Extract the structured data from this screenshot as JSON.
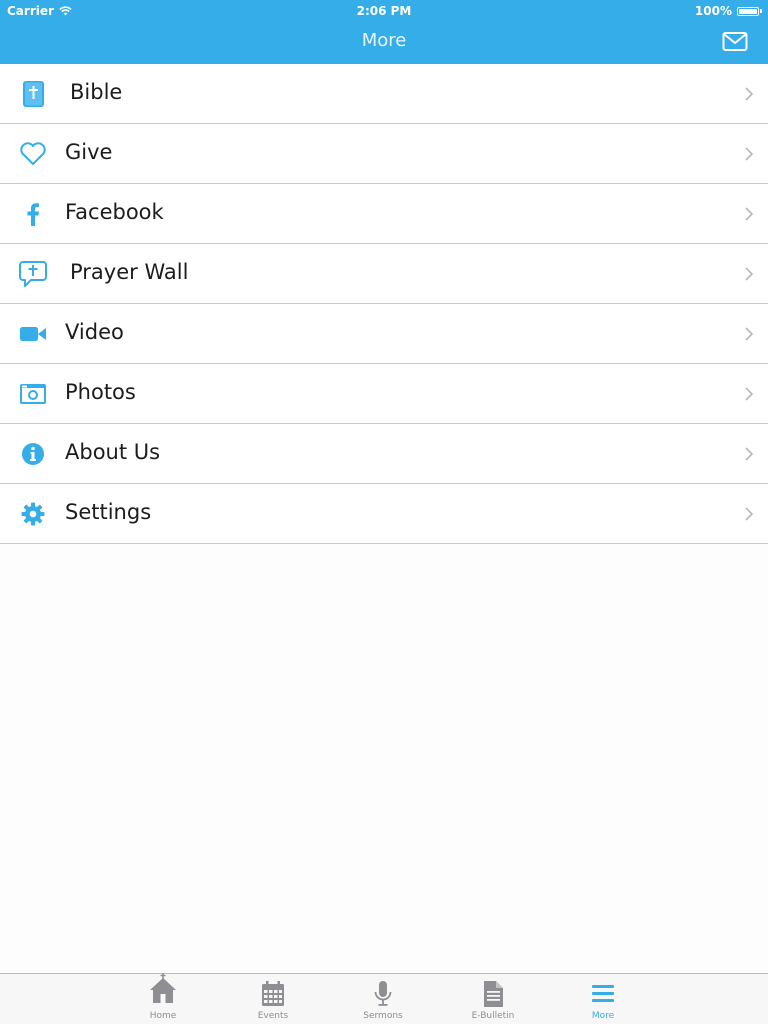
{
  "status_bar": {
    "carrier": "Carrier",
    "time": "2:06 PM",
    "battery": "100%"
  },
  "header": {
    "title": "More",
    "mail_icon": "envelope-icon"
  },
  "menu": {
    "items": [
      {
        "label": "Bible",
        "icon": "bible-icon"
      },
      {
        "label": "Give",
        "icon": "heart-icon"
      },
      {
        "label": "Facebook",
        "icon": "facebook-icon"
      },
      {
        "label": "Prayer Wall",
        "icon": "prayer-bubble-icon"
      },
      {
        "label": "Video",
        "icon": "video-camera-icon"
      },
      {
        "label": "Photos",
        "icon": "camera-icon"
      },
      {
        "label": "About Us",
        "icon": "info-icon"
      },
      {
        "label": "Settings",
        "icon": "gear-icon"
      }
    ]
  },
  "tabbar": {
    "tabs": [
      {
        "label": "Home",
        "icon": "church-icon"
      },
      {
        "label": "Events",
        "icon": "calendar-icon"
      },
      {
        "label": "Sermons",
        "icon": "microphone-icon"
      },
      {
        "label": "E-Bulletin",
        "icon": "document-icon"
      },
      {
        "label": "More",
        "icon": "menu-lines-icon",
        "active": true
      }
    ]
  },
  "colors": {
    "accent": "#35ade9",
    "separator": "#c9c9cc",
    "tab_inactive": "#8e8e93"
  }
}
